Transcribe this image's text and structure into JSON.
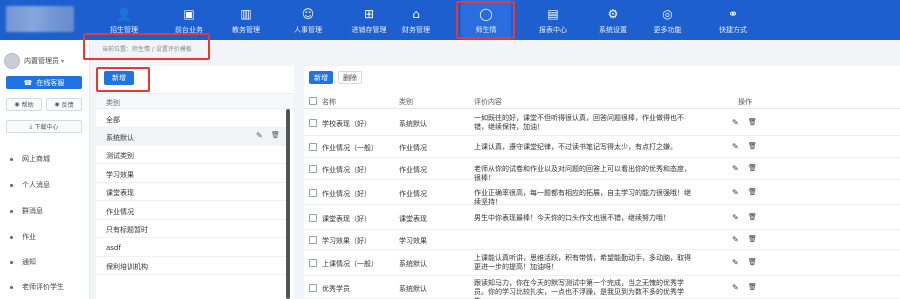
{
  "nav": [
    {
      "label": "招生管理",
      "icon": "user-icon"
    },
    {
      "label": "前台业务",
      "icon": "image-icon"
    },
    {
      "label": "教务管理",
      "icon": "book-icon"
    },
    {
      "label": "人事管理",
      "icon": "person-icon"
    },
    {
      "label": "进销存管理",
      "icon": "plus-box-icon"
    },
    {
      "label": "财务管理",
      "icon": "home-icon"
    },
    {
      "label": "师生情",
      "icon": "chat-icon"
    },
    {
      "label": "报表中心",
      "icon": "chart-icon"
    },
    {
      "label": "系统设置",
      "icon": "gear-icon"
    },
    {
      "label": "更多功能",
      "icon": "more-icon"
    },
    {
      "label": "快捷方式",
      "icon": "link-icon"
    }
  ],
  "active_nav": "师生情",
  "colors": {
    "brand": "#1e5fcf",
    "accent": "#1e74e5",
    "highlight": "#e53935"
  },
  "user": {
    "name": "内置管理员"
  },
  "sidebar": {
    "online_label": "在线客服",
    "help_label": "帮助",
    "feedback_label": "反馈",
    "download_label": "下载中心",
    "items": [
      {
        "label": "网上商城"
      },
      {
        "label": "个人消息"
      },
      {
        "label": "群消息"
      },
      {
        "label": "作业"
      },
      {
        "label": "通知"
      },
      {
        "label": "老师评价学生"
      }
    ]
  },
  "breadcrumb": "当前位置：师生情 / 设置评价模板",
  "category": {
    "new_label": "新增",
    "header": "类别",
    "items": [
      "全部",
      "系统默认",
      "测试类别",
      "学习效果",
      "课堂表现",
      "作业情况",
      "只有标题暂时",
      "asdf",
      "保利培训机构"
    ]
  },
  "toolbar": {
    "add_label": "新增",
    "delete_label": "删除"
  },
  "table": {
    "headers": {
      "name": "名称",
      "category": "类别",
      "content": "评价内容",
      "ops": "操作"
    },
    "rows": [
      {
        "name": "学校表现（好）",
        "category": "系统默认",
        "content": "一如既往的好，课堂不但听得很认真，回答问题很棒，作业做得也不错，继续保持，加油！"
      },
      {
        "name": "作业情况（一般）",
        "category": "作业情况",
        "content": "上课认真，遵守课堂纪律，不过读书笔记写得太少，有点打之嫌。"
      },
      {
        "name": "作业情况（好）",
        "category": "作业情况",
        "content": "老师从你的试卷和作业以及对问题的回答上可以看出你的优秀和态度，很棒！"
      },
      {
        "name": "作业情况（好）",
        "category": "作业情况",
        "content": "作业正确率很高，每一题都有相应的拓展，自主学习的能力很强哦！继续坚持！"
      },
      {
        "name": "课堂表现（好）",
        "category": "课堂表现",
        "content": "男生中你表现最棒！今天你的口头作文也很不错，继续努力哦！"
      },
      {
        "name": "学习效果（好）",
        "category": "学习效果",
        "content": ""
      },
      {
        "name": "上课情况（一般）",
        "category": "系统默认",
        "content": "上课能认真听讲，思维活跃，积有带情，希望能勤动手，多动脑，取得更进一步的提高！加油呀！"
      },
      {
        "name": "优秀学员",
        "category": "系统默认",
        "content": "跟读知马力，你在今天的默写测试中第一个完成，当之无愧的优秀学员。你的学习比较扎实，一点也不浮躁，是我见到为数不多的优秀学生。"
      }
    ]
  }
}
